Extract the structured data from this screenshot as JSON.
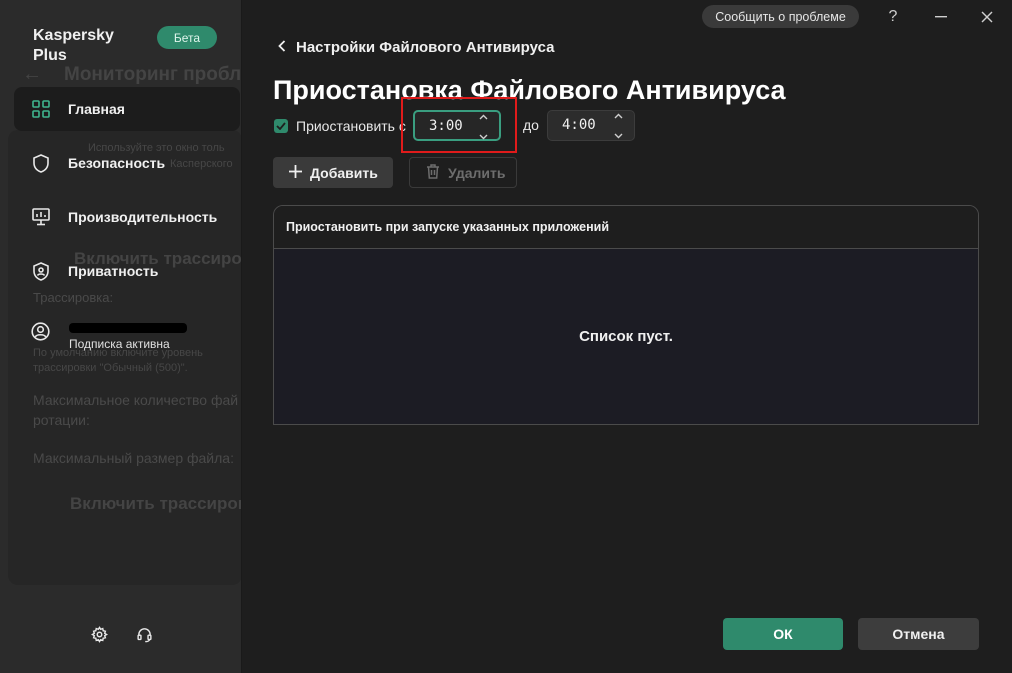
{
  "app": {
    "brand": "Kaspersky Plus",
    "beta_badge": "Бета",
    "report_button": "Сообщить о проблеме"
  },
  "background_window": {
    "title": "Мониторинг пробл",
    "info_line1": "Используйте это окно толь",
    "info_line2": "Касперского",
    "trace_toggle": "Включить трассиров",
    "trace_label": "Трассировка:",
    "default_note_line1": "По умолчанию включите уровень",
    "default_note_line2": "трассировки \"Обычный (500)\".",
    "max_files_line1": "Максимальное количество фай",
    "max_files_line2": "ротации:",
    "max_size": "Максимальный размер файла:",
    "trace_toggle2": "Включить трассировку"
  },
  "sidebar": {
    "items": [
      {
        "label": "Главная",
        "icon": "dashboard-icon"
      },
      {
        "label": "Безопасность",
        "icon": "shield-icon"
      },
      {
        "label": "Производительность",
        "icon": "monitor-icon"
      },
      {
        "label": "Приватность",
        "icon": "privacy-shield-icon"
      }
    ],
    "account_status": "Подписка активна",
    "footer_icons": [
      "settings-gear-icon",
      "support-headset-icon"
    ]
  },
  "window_controls": {
    "help": "?",
    "minimize": "—",
    "close": "✕"
  },
  "page": {
    "back_label": "Настройки Файлового Антивируса",
    "title": "Приостановка Файлового Антивируса",
    "pause_checkbox_label": "Приостановить с",
    "pause_checked": true,
    "from_time": "3:00",
    "to_label": "до",
    "to_time": "4:00",
    "add_button": "Добавить",
    "delete_button": "Удалить",
    "list_header": "Приостановить при запуске указанных приложений",
    "list_empty": "Список пуст.",
    "ok_button": "ОК",
    "cancel_button": "Отмена"
  },
  "colors": {
    "accent": "#2f8a6c",
    "highlight": "#e01b1b",
    "background": "#1e1e1e",
    "sidebar": "#2b2b2b"
  }
}
